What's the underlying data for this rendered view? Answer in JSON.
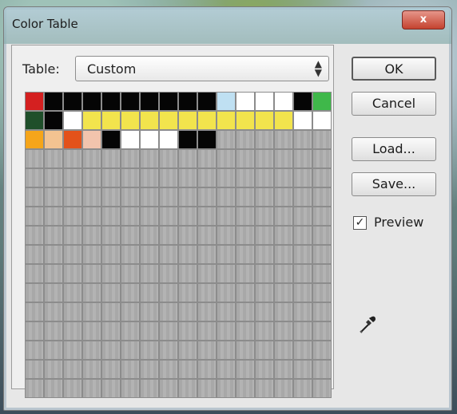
{
  "window": {
    "title": "Color Table",
    "close_label": "x"
  },
  "table": {
    "label": "Table:",
    "value": "Custom"
  },
  "buttons": {
    "ok": "OK",
    "cancel": "Cancel",
    "load": "Load...",
    "save": "Save..."
  },
  "preview": {
    "label": "Preview",
    "checked": true
  },
  "icons": {
    "close": "close-icon",
    "dropdown": "updown-arrows-icon",
    "eyedropper": "eyedropper-icon",
    "check": "check-icon"
  },
  "swatches": {
    "empty_color": "#a7a7a7",
    "rows": [
      [
        "#d42020",
        "#050505",
        "#050505",
        "#050505",
        "#050505",
        "#050505",
        "#050505",
        "#050505",
        "#050505",
        "#050505",
        "#bfe0f2",
        "#ffffff",
        "#ffffff",
        "#ffffff",
        "#050505",
        "#3fb84a"
      ],
      [
        "#1f4f2a",
        "#050505",
        "#ffffff",
        "#f2e44d",
        "#f2e44d",
        "#f2e44d",
        "#f2e44d",
        "#f2e44d",
        "#f2e44d",
        "#f2e44d",
        "#f2e44d",
        "#f2e44d",
        "#f2e44d",
        "#f2e44d",
        "#ffffff",
        "#ffffff"
      ],
      [
        "#f5a51a",
        "#f3c391",
        "#e3521a",
        "#f2c4ad",
        "#050505",
        "#ffffff",
        "#ffffff",
        "#ffffff",
        "#050505",
        "#050505"
      ]
    ]
  }
}
